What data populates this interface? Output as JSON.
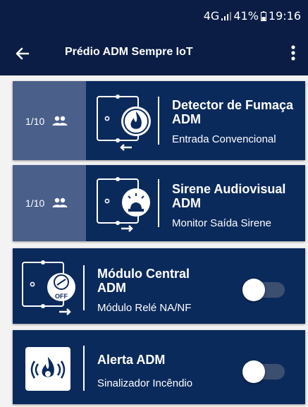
{
  "status_bar": {
    "network": "4G",
    "battery": "41%",
    "time": "19:16"
  },
  "app_bar": {
    "title": "Prédio ADM Sempre IoT"
  },
  "cards": [
    {
      "counter": "1/10",
      "name_line1": "Detector de Fumaça",
      "name_line2": "ADM",
      "subtitle": "Entrada Convencional",
      "icon": "smoke-detector-icon"
    },
    {
      "counter": "1/10",
      "name_line1": "Sirene Audiovisual",
      "name_line2": "ADM",
      "subtitle": "Monitor Saída Sirene",
      "icon": "siren-icon"
    },
    {
      "name_line1": "Módulo Central",
      "name_line2": "ADM",
      "subtitle": "Módulo Relé NA/NF",
      "icon": "relay-module-icon",
      "toggle_on": false,
      "badge": "OFF"
    },
    {
      "name_line1": "Alerta ADM",
      "subtitle": "Sinalizador Incêndio",
      "icon": "fire-alert-icon",
      "toggle_on": false
    }
  ],
  "colors": {
    "app_bar": "#0b1d45",
    "card": "#0b2a5c",
    "counter_panel": "#4a5f8a",
    "list_background": "#f3f3f3"
  }
}
